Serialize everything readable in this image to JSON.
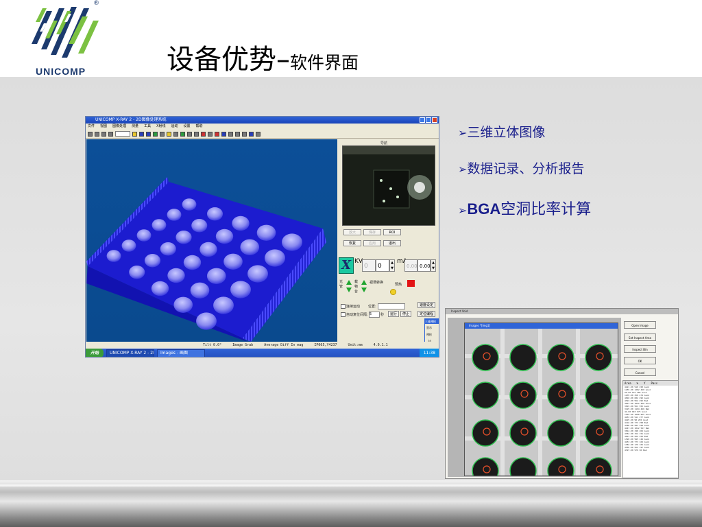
{
  "logo": {
    "text": "UNICOMP",
    "registered": "®",
    "brand_color": "#1c3a6e",
    "accent_color": "#7cc142"
  },
  "title": {
    "main": "设备优势",
    "dash": "–",
    "sub": "软件界面"
  },
  "bullets": [
    {
      "arrow": "➢",
      "text": "三维立体图像"
    },
    {
      "arrow": "➢",
      "text": "数据记录、分析报告"
    },
    {
      "arrow": "➢",
      "prefix": "BGA",
      "text": "空洞比率计算"
    }
  ],
  "screenshot_main": {
    "window_title": "UNICOMP X-RAY 2 - 2D图像处理系统",
    "menu": [
      "文件",
      "视图",
      "图像处理",
      "测量",
      "工具",
      "X射线",
      "运动",
      "设置",
      "帮助"
    ],
    "camera_label": "导航",
    "buttons": {
      "b1": "放大",
      "b2": "保存",
      "roi": "ROI",
      "recover": "恢复",
      "apply": "应用",
      "exit": "退出",
      "speed": "速度设定",
      "position": "定位编程",
      "run": "运行",
      "stop": "停止"
    },
    "kv_label": "KV",
    "kv_value": "0",
    "ma_label": "mA",
    "ma_value": "0.00",
    "kv_field": "0",
    "ma_field": "0.00",
    "xray_label": "光管",
    "motion_label": "载物台",
    "switch_label": "视场转换",
    "preheat_label": "预热",
    "continuous_label": "连续运动",
    "position_label": "位置:",
    "auto_return_label": "自动复位",
    "step_label": "间隔:",
    "step_value": "5",
    "seconds_label": "秒",
    "side_title": "三维预检",
    "side_check": "显示",
    "side_label": "预检",
    "side_value": "20",
    "status": [
      "Tilt 0.0°",
      "Image Grab",
      "Average Diff In mag",
      "IP065,Y4237",
      "Unit:mm",
      "4.0.1.1"
    ],
    "taskbar": {
      "start": "开始",
      "task1": "UNICOMP X-RAY 2 - 2D",
      "task2": "Images - 画图",
      "time": "11:38"
    }
  },
  "screenshot_bga": {
    "window_title": "Inspect Void",
    "child_title": "Images *[Img1]",
    "buttons": [
      "Open Image",
      "Set Inspect Area",
      "Inspect Bin",
      "OK",
      "Cancel"
    ],
    "table_headers": [
      "Area",
      "%",
      "Y",
      "Pass"
    ],
    "table_rows": [
      "4221.00  910  450  Good",
      "1255.00  1282  460  Good",
      "96.00  976  486  Good",
      "1235.00  258  474  Good",
      "4810.00  682  495  Good",
      "4522.00  952  495  Bad",
      "4813.00  1052  460  Good",
      "3815.00  951  555  Good",
      "3125.00  1194  466  Bad",
      "44.00  993  975  Good",
      "1564.00  1008  965  Good",
      "4253.00  911  277  Good",
      "4225.00  98  265  Good",
      "4116.00  773  258  Bad",
      "4386.00  993  594  Good",
      "4447.00  1042  597  Bad",
      "3814.00  348  262  Good",
      "4352.00  152  151  Good",
      "4813.00  562  252  Bad",
      "1520.00  995  129  Good",
      "4253.00  773  162  Good",
      "1382.00  179  165  Good",
      "4556.00  952  197  Good",
      "4397.00  979  96  Bad"
    ]
  }
}
